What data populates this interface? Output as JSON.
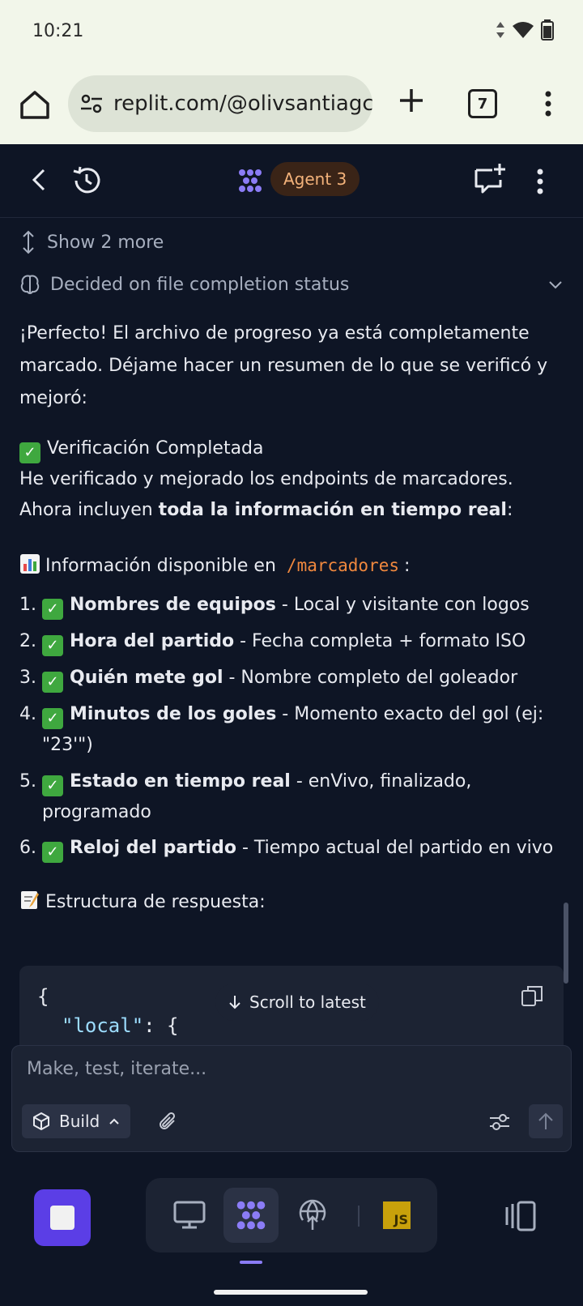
{
  "status_bar": {
    "time": "10:21"
  },
  "browser": {
    "url": "replit.com/@olivsantiagc",
    "tab_count": "7"
  },
  "header": {
    "agent_label": "Agent 3"
  },
  "chat": {
    "show_more": "Show 2 more",
    "thought_status": "Decided on file completion status",
    "intro": "¡Perfecto! El archivo de progreso ya está completamente marcado. Déjame hacer un resumen de lo que se verificó y mejoró:",
    "verification_heading": "Verificación Completada",
    "verification_line": "He verificado y mejorado los endpoints de marcadores.",
    "includes_prefix": "Ahora incluyen ",
    "includes_bold": "toda la información en tiempo real",
    "includes_suffix": ":",
    "info_prefix": "Información disponible en",
    "info_code": "/marcadores",
    "info_suffix": ":",
    "items": [
      {
        "num": "1.",
        "bold": "Nombres de equipos",
        "rest": " - Local y visitante con logos"
      },
      {
        "num": "2.",
        "bold": "Hora del partido",
        "rest": " - Fecha completa + formato ISO"
      },
      {
        "num": "3.",
        "bold": "Quién mete gol",
        "rest": " - Nombre completo del goleador"
      },
      {
        "num": "4.",
        "bold": "Minutos de los goles",
        "rest": " - Momento exacto del gol (ej: \"23'\")"
      },
      {
        "num": "5.",
        "bold": "Estado en tiempo real",
        "rest": " - enVivo, finalizado, programado"
      },
      {
        "num": "6.",
        "bold": "Reloj del partido",
        "rest": " - Tiempo actual del partido en vivo"
      }
    ],
    "structure_heading": "Estructura de respuesta:",
    "code_line1": "{",
    "code_key": "\"local\"",
    "code_after": ": {",
    "scroll_to_latest": "Scroll to latest"
  },
  "composer": {
    "placeholder": "Make, test, iterate...",
    "mode_label": "Build"
  },
  "dock": {
    "js_label": "JS"
  },
  "icons": {
    "emoji_check": "check-mark-icon",
    "emoji_chart": "bar-chart-icon",
    "emoji_memo": "memo-icon"
  }
}
